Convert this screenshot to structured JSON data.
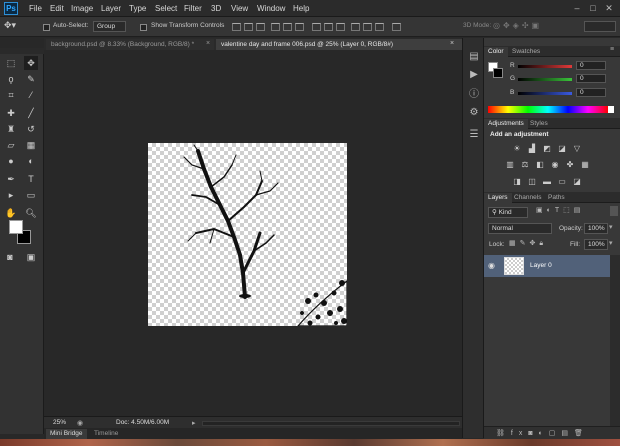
{
  "app": {
    "logo": "Ps"
  },
  "menu": [
    "File",
    "Edit",
    "Image",
    "Layer",
    "Type",
    "Select",
    "Filter",
    "3D",
    "View",
    "Window",
    "Help"
  ],
  "window_controls": {
    "minimize": "–",
    "maximize": "□",
    "close": "✕"
  },
  "options": {
    "auto_select_label": "Auto-Select:",
    "auto_select_value": "Group",
    "show_transform_label": "Show Transform Controls",
    "mode_3d_label": "3D Mode:"
  },
  "tabs": [
    {
      "label": "background.psd @ 8.33% (Background, RGB/8) *",
      "active": false
    },
    {
      "label": "valentine day and frame 006.psd @ 25% (Layer 0, RGB/8#)",
      "active": true
    }
  ],
  "status": {
    "zoom": "25%",
    "doc_info": "Doc: 4.50M/6.00M"
  },
  "bottom_tabs": [
    "Mini Bridge",
    "Timeline"
  ],
  "color_panel": {
    "tabs": [
      "Color",
      "Swatches"
    ],
    "channels": [
      {
        "label": "R",
        "value": "0",
        "color": "#e23a3a"
      },
      {
        "label": "G",
        "value": "0",
        "color": "#3ac43a"
      },
      {
        "label": "B",
        "value": "0",
        "color": "#3a5ae2"
      }
    ]
  },
  "adjustments_panel": {
    "tabs": [
      "Adjustments",
      "Styles"
    ],
    "heading": "Add an adjustment"
  },
  "layers_panel": {
    "tabs": [
      "Layers",
      "Channels",
      "Paths"
    ],
    "kind_label": "Kind",
    "blend_mode": "Normal",
    "opacity_label": "Opacity:",
    "opacity_value": "100%",
    "lock_label": "Lock:",
    "fill_label": "Fill:",
    "fill_value": "100%",
    "layers": [
      {
        "name": "Layer 0",
        "visible": true,
        "selected": true
      }
    ]
  },
  "colors": {
    "selection_blue": "#516179",
    "ps_blue": "#31a8ff"
  }
}
